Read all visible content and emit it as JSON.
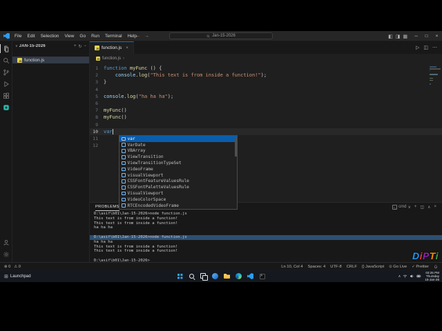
{
  "window": {
    "title": "Jan-15-2026",
    "menus": [
      "File",
      "Edit",
      "Selection",
      "View",
      "Go",
      "Run",
      "Terminal",
      "Help"
    ],
    "layout_icons": [
      "toggle-sidebar",
      "toggle-panel",
      "customize-layout"
    ],
    "controls": [
      "minimize",
      "maximize",
      "close"
    ]
  },
  "activity_bar": {
    "top": [
      {
        "name": "explorer",
        "active": true
      },
      {
        "name": "search"
      },
      {
        "name": "source-control"
      },
      {
        "name": "run-debug"
      },
      {
        "name": "extensions"
      },
      {
        "name": "live-server"
      }
    ],
    "bottom": [
      {
        "name": "account"
      },
      {
        "name": "settings"
      }
    ]
  },
  "sidebar": {
    "section": "JAN-15-2026",
    "actions": [
      "new-file",
      "refresh-explorer",
      "collapse-folders"
    ],
    "files": [
      {
        "label": "function.js",
        "selected": true
      }
    ]
  },
  "editor": {
    "tabs": [
      {
        "label": "function.js",
        "active": true
      }
    ],
    "actions": [
      "run",
      "split-editor",
      "more-actions"
    ],
    "breadcrumb": [
      "function.js"
    ],
    "lines": [
      {
        "num": 1,
        "segs": [
          {
            "k": "kw",
            "t": "function"
          },
          {
            "k": "pl",
            "t": " "
          },
          {
            "k": "fn",
            "t": "myFunc"
          },
          {
            "k": "pl",
            "t": " () {"
          }
        ]
      },
      {
        "num": 2,
        "segs": [
          {
            "k": "pl",
            "t": "    "
          },
          {
            "k": "vr",
            "t": "console"
          },
          {
            "k": "pl",
            "t": "."
          },
          {
            "k": "fn",
            "t": "log"
          },
          {
            "k": "pl",
            "t": "("
          },
          {
            "k": "str",
            "t": "\"This text is from inside a function!\""
          },
          {
            "k": "pl",
            "t": ");"
          }
        ]
      },
      {
        "num": 3,
        "segs": [
          {
            "k": "pl",
            "t": "}"
          }
        ]
      },
      {
        "num": 4,
        "segs": []
      },
      {
        "num": 5,
        "segs": [
          {
            "k": "vr",
            "t": "console"
          },
          {
            "k": "pl",
            "t": "."
          },
          {
            "k": "fn",
            "t": "log"
          },
          {
            "k": "pl",
            "t": "("
          },
          {
            "k": "str",
            "t": "\"ha ha ha\""
          },
          {
            "k": "pl",
            "t": ");"
          }
        ]
      },
      {
        "num": 6,
        "segs": []
      },
      {
        "num": 7,
        "segs": [
          {
            "k": "fn",
            "t": "myFunc"
          },
          {
            "k": "pl",
            "t": "()"
          }
        ]
      },
      {
        "num": 8,
        "segs": [
          {
            "k": "fn",
            "t": "myFunc"
          },
          {
            "k": "pl",
            "t": "()"
          }
        ]
      },
      {
        "num": 9,
        "segs": []
      },
      {
        "num": 10,
        "segs": [
          {
            "k": "kw",
            "t": "var"
          }
        ],
        "active": true,
        "cursor": true
      },
      {
        "num": 11,
        "segs": []
      },
      {
        "num": 12,
        "segs": []
      }
    ]
  },
  "suggest": {
    "selected_index": 0,
    "items": [
      {
        "label": "var",
        "kind": "keyword"
      },
      {
        "label": "VarDate",
        "kind": "class"
      },
      {
        "label": "VBArray",
        "kind": "class"
      },
      {
        "label": "ViewTransition",
        "kind": "class"
      },
      {
        "label": "ViewTransitionTypeSet",
        "kind": "class"
      },
      {
        "label": "VideoFrame",
        "kind": "class"
      },
      {
        "label": "visualViewport",
        "kind": "variable"
      },
      {
        "label": "CSSFontFeatureValuesRule",
        "kind": "class"
      },
      {
        "label": "CSSFontPaletteValuesRule",
        "kind": "class"
      },
      {
        "label": "VisualViewport",
        "kind": "class"
      },
      {
        "label": "VideoColorSpace",
        "kind": "class"
      },
      {
        "label": "RTCEncodedVideoFrame",
        "kind": "class"
      }
    ]
  },
  "panel": {
    "tabs": [
      {
        "label": "PROBLEMS",
        "active": true
      }
    ],
    "shell_label": "cmd",
    "actions": [
      "new-terminal",
      "split-terminal",
      "maximize-panel",
      "close-panel"
    ],
    "terminal_lines": [
      {
        "text": "D:\\asif\\b01\\Jan-15-2026>node function.js"
      },
      {
        "text": "This text is from inside a function!"
      },
      {
        "text": "This text is from inside a function!"
      },
      {
        "text": "ha ha ha"
      },
      {
        "text": ""
      },
      {
        "text": "D:\\asif\\b01\\Jan-15-2026>node function.js",
        "highlight": true
      },
      {
        "text": "ha ha ha"
      },
      {
        "text": "This text is from inside a function!"
      },
      {
        "text": "This text is from inside a function!"
      },
      {
        "text": ""
      },
      {
        "text": "D:\\asif\\b01\\Jan-15-2026>"
      }
    ]
  },
  "status_bar": {
    "left": [
      {
        "name": "errors-indicator",
        "icon": "⊗",
        "label": "0"
      },
      {
        "name": "warnings-indicator",
        "icon": "⚠",
        "label": "0"
      }
    ],
    "right": [
      {
        "name": "cursor-position",
        "label": "Ln 10, Col 4"
      },
      {
        "name": "indentation",
        "label": "Spaces: 4"
      },
      {
        "name": "encoding",
        "label": "UTF-8"
      },
      {
        "name": "eol-sequence",
        "label": "CRLF"
      },
      {
        "name": "language-mode",
        "icon": "{}",
        "label": "JavaScript"
      },
      {
        "name": "go-live",
        "icon": "⊙",
        "label": "Go Live"
      },
      {
        "name": "prettier",
        "icon": "✓",
        "label": "Prettier"
      }
    ]
  },
  "taskbar": {
    "launchpad_label": "Launchpad",
    "icons": [
      "start",
      "search",
      "task-view",
      "widgets",
      "file-explorer",
      "edge",
      "vscode",
      "terminal"
    ],
    "clock": {
      "time": "03:25 PM",
      "day": "Thursday",
      "date": "15-Jan-26"
    }
  },
  "watermark": {
    "letters": [
      {
        "ch": "D",
        "color": "#2196f3"
      },
      {
        "ch": "i",
        "color": "#e53935"
      },
      {
        "ch": "P",
        "color": "#8e24aa"
      },
      {
        "ch": "T",
        "color": "#fb8c00"
      },
      {
        "ch": "i",
        "color": "#43a047"
      }
    ]
  }
}
